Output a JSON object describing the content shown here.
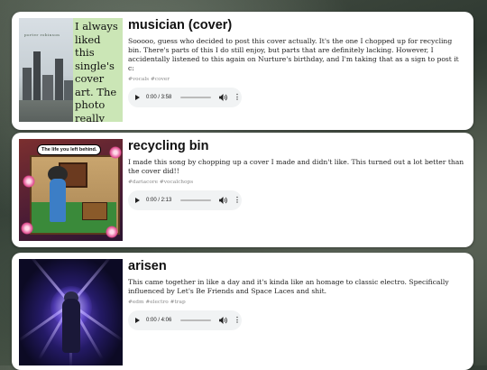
{
  "posts": [
    {
      "title": "musician (cover)",
      "description": "Sooooo, guess who decided to post this cover actually. It's the one I chopped up for recycling bin. There's parts of this I do still enjoy, but parts that are definitely lacking. However, I accidentally listened to this again on Nurture's birthday, and I'm taking that as a sign to post it c:",
      "tags": "#vocals #cover",
      "time": "0:00 / 3:58",
      "art_caption": "I always liked this single's cover art. The photo really feels nice",
      "art_logo": "porter robinson"
    },
    {
      "title": "recycling bin",
      "description": "I made this song by chopping up a cover I made and didn't like. This turned out a lot better than the cover did!!",
      "tags": "#dariacore #vocalchops",
      "time": "0:00 / 2:13",
      "art_bubble": "The life you left behind."
    },
    {
      "title": "arisen",
      "description": "This came together in like a day and it's kinda like an homage to classic electro. Specifically influenced by Let's Be Friends and Space Laces and shit.",
      "tags": "#edm #electro #trap",
      "time": "0:00 / 4:06"
    }
  ]
}
